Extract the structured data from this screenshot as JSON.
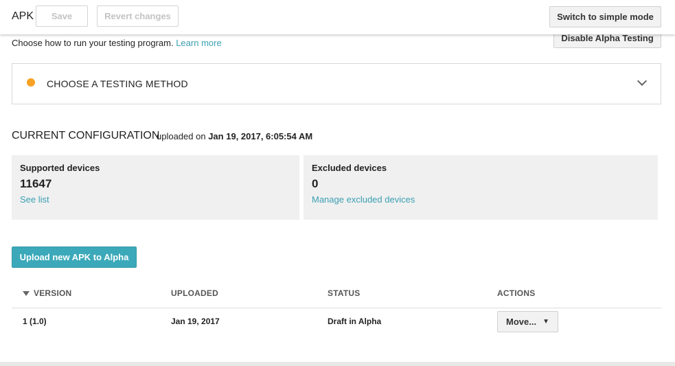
{
  "header": {
    "title": "APK",
    "save_label": "Save",
    "revert_label": "Revert changes",
    "simple_mode_label": "Switch to simple mode"
  },
  "disable_alpha_label": "Disable Alpha Testing",
  "intro": {
    "text": "Choose how to run your testing program.",
    "learn_more": "Learn more"
  },
  "testing_method": {
    "label": "CHOOSE A TESTING METHOD",
    "status_color": "#f7a125"
  },
  "configuration": {
    "title": "CURRENT CONFIGURATION",
    "uploaded_prefix": "uploaded on",
    "uploaded_date": "Jan 19, 2017, 6:05:54 AM"
  },
  "cards": {
    "supported": {
      "label": "Supported devices",
      "value": "11647",
      "link": "See list"
    },
    "excluded": {
      "label": "Excluded devices",
      "value": "0",
      "link": "Manage excluded devices"
    }
  },
  "upload_label": "Upload new APK to Alpha",
  "table": {
    "columns": [
      "VERSION",
      "UPLOADED",
      "STATUS",
      "ACTIONS"
    ],
    "rows": [
      {
        "version": "1 (1.0)",
        "uploaded": "Jan 19, 2017",
        "status": "Draft in Alpha",
        "action": "Move..."
      }
    ]
  },
  "accent_color": "#3ba9b9"
}
